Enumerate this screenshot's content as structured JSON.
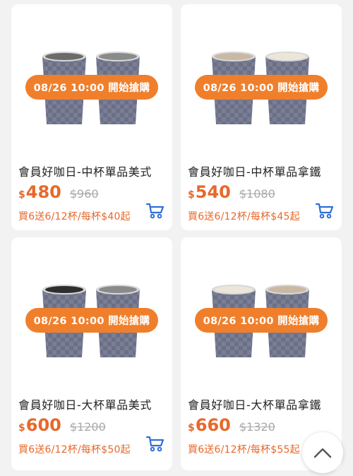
{
  "products": [
    {
      "badge": "08/26 10:00 開始搶購",
      "name": "會員好咖日-中杯單品美式",
      "currency": "$",
      "price": "480",
      "original_price": "$960",
      "promo": "買6送6/12杯/每杯$40起",
      "left_drink": "#6b6b6b",
      "right_drink": "#8a8a8a"
    },
    {
      "badge": "08/26 10:00 開始搶購",
      "name": "會員好咖日-中杯單品拿鐵",
      "currency": "$",
      "price": "540",
      "original_price": "$1080",
      "promo": "買6送6/12杯/每杯$45起",
      "left_drink": "#c9b8a4",
      "right_drink": "#ece6da"
    },
    {
      "badge": "08/26 10:00 開始搶購",
      "name": "會員好咖日-大杯單品美式",
      "currency": "$",
      "price": "600",
      "original_price": "$1200",
      "promo": "買6送6/12杯/每杯$50起",
      "left_drink": "#2e2e2e",
      "right_drink": "#8a8a8a"
    },
    {
      "badge": "08/26 10:00 開始搶購",
      "name": "會員好咖日-大杯單品拿鐵",
      "currency": "$",
      "price": "660",
      "original_price": "$1320",
      "promo": "買6送6/12杯/每杯$55起",
      "left_drink": "#ece6da",
      "right_drink": "#c9b8a4"
    }
  ],
  "colors": {
    "accent": "#e8682a",
    "badge": "#f07f2c",
    "cart_icon": "#2f6fd8",
    "cup": "#7b7f95"
  },
  "icons": {
    "cart": "cart-icon",
    "scroll_top": "chevron-up-icon"
  }
}
